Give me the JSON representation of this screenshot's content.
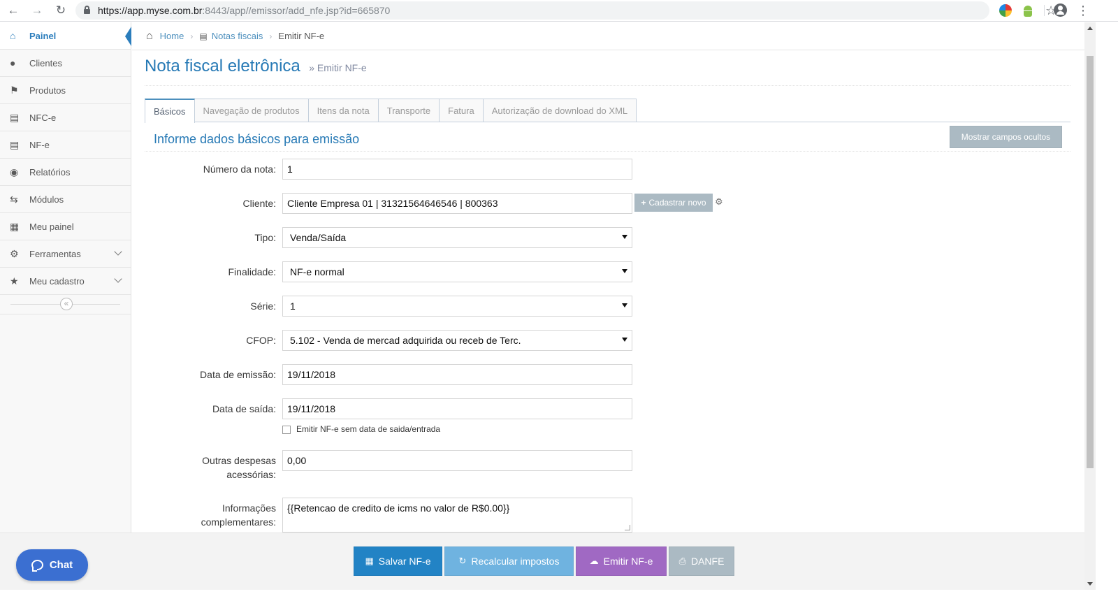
{
  "browser": {
    "url_host": "https://app.myse.com.br",
    "url_rest": ":8443/app//emissor/add_nfe.jsp?id=665870",
    "icons": [
      "back-icon",
      "forward-icon",
      "reload-icon",
      "lock-icon",
      "star-icon",
      "avatar-icon"
    ]
  },
  "sidebar": {
    "items": [
      {
        "label": "Painel",
        "icon": "home-icon"
      },
      {
        "label": "Clientes",
        "icon": "user-icon"
      },
      {
        "label": "Produtos",
        "icon": "tags-icon"
      },
      {
        "label": "NFC-e",
        "icon": "list-icon"
      },
      {
        "label": "NF-e",
        "icon": "list-icon"
      },
      {
        "label": "Relatórios",
        "icon": "gamepad-icon"
      },
      {
        "label": "Módulos",
        "icon": "random-icon"
      },
      {
        "label": "Meu painel",
        "icon": "grid-icon"
      },
      {
        "label": "Ferramentas",
        "icon": "gear-icon"
      },
      {
        "label": "Meu cadastro",
        "icon": "star-icon"
      }
    ]
  },
  "breadcrumb": {
    "home": "Home",
    "notas": "Notas fiscais",
    "current": "Emitir NF-e"
  },
  "header": {
    "title": "Nota fiscal eletrônica",
    "subtitle": "» Emitir NF-e"
  },
  "tabs": [
    "Básicos",
    "Navegação de produtos",
    "Itens da nota",
    "Transporte",
    "Fatura",
    "Autorização de download do XML"
  ],
  "section": {
    "title": "Informe dados básicos para emissão",
    "show_hidden": "Mostrar campos ocultos"
  },
  "form": {
    "numero_label": "Número da nota:",
    "numero_value": "1",
    "cliente_label": "Cliente:",
    "cliente_value": "Cliente Empresa 01 | 31321564646546 | 800363",
    "cadastrar_novo": "Cadastrar novo",
    "tipo_label": "Tipo:",
    "tipo_value": "Venda/Saída",
    "finalidade_label": "Finalidade:",
    "finalidade_value": "NF-e normal",
    "serie_label": "Série:",
    "serie_value": "1",
    "cfop_label": "CFOP:",
    "cfop_value": "5.102 - Venda de mercad adquirida ou receb de Terc.",
    "emissao_label": "Data de emissão:",
    "emissao_value": "19/11/2018",
    "saida_label": "Data de saída:",
    "saida_value": "19/11/2018",
    "sem_data_label": "Emitir NF-e sem data de saida/entrada",
    "outras_label_1": "Outras despesas",
    "outras_label_2": "acessórias:",
    "outras_value": "0,00",
    "info_label_1": "Informações",
    "info_label_2": "complementares:",
    "info_value": "{{Retencao de credito de icms no valor de R$0.00}}"
  },
  "footer": {
    "chat": "Chat",
    "salvar": "Salvar NF-e",
    "recalcular": "Recalcular impostos",
    "emitir": "Emitir NF-e",
    "danfe": "DANFE"
  },
  "colors": {
    "accent": "#2679b5",
    "salvar": "#2283c5",
    "recalcular": "#6fb3e0",
    "emitir": "#a069c3",
    "danfe": "#abbac3",
    "chat": "#3b6fd1"
  }
}
